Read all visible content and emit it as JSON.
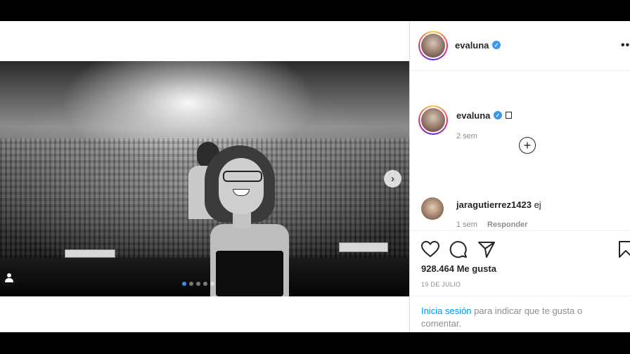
{
  "post": {
    "photo_alt": "",
    "carousel": {
      "count": 5,
      "active_index": 0
    }
  },
  "header": {
    "username": "evaluna",
    "more_label": "••"
  },
  "caption": {
    "username": "evaluna",
    "time": "2 sem"
  },
  "comments": [
    {
      "username": "jaragutierrez1423",
      "text": "ej",
      "time": "1 sem",
      "reply_label": "Responder"
    }
  ],
  "actions": {
    "likes": "928.464 Me gusta",
    "date": "19 DE JULIO"
  },
  "login_prompt": {
    "link": "Inicia sesión",
    "text": " para indicar que te gusta o comentar."
  },
  "colors": {
    "verified": "#3897f0",
    "link": "#0095f6"
  }
}
